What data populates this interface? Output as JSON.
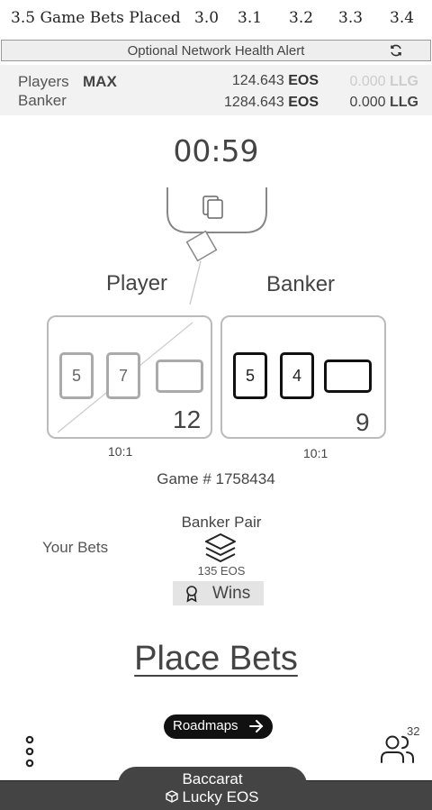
{
  "header": {
    "title": "3.5 Game Bets Placed",
    "versions": [
      "3.0",
      "3.1",
      "3.2",
      "3.3",
      "3.4"
    ]
  },
  "alert": {
    "text": "Optional Network Health Alert",
    "icon": "refresh-icon"
  },
  "balances": {
    "players_label": "Players",
    "max_label": "MAX",
    "banker_label": "Banker",
    "players_eos_value": "124.643",
    "banker_eos_value": "1284.643",
    "eos_unit": "EOS",
    "players_llg_value": "0.000",
    "banker_llg_value": "0.000",
    "llg_unit": "LLG"
  },
  "timer": "00:59",
  "table": {
    "player_label": "Player",
    "banker_label": "Banker",
    "player_cards": [
      "5",
      "7",
      ""
    ],
    "banker_cards": [
      "5",
      "4",
      ""
    ],
    "player_total": "12",
    "banker_total": "9",
    "player_odds": "10:1",
    "banker_odds": "10:1"
  },
  "game_number": "Game # 1758434",
  "bets": {
    "your_bets_label": "Your Bets",
    "bet_name": "Banker Pair",
    "bet_amount": "135 EOS",
    "result": "Wins",
    "icons": [
      "layers-icon",
      "award-icon"
    ]
  },
  "place_bets": "Place Bets",
  "roadmaps": "Roadmaps",
  "players_count": "32",
  "footer": {
    "title": "Baccarat",
    "subtitle": "Lucky EOS"
  },
  "colors": {
    "dark": "#444444",
    "muted_card": "#aaaaaa",
    "llg_dim": "#cccccc",
    "button_bg": "#111111"
  }
}
